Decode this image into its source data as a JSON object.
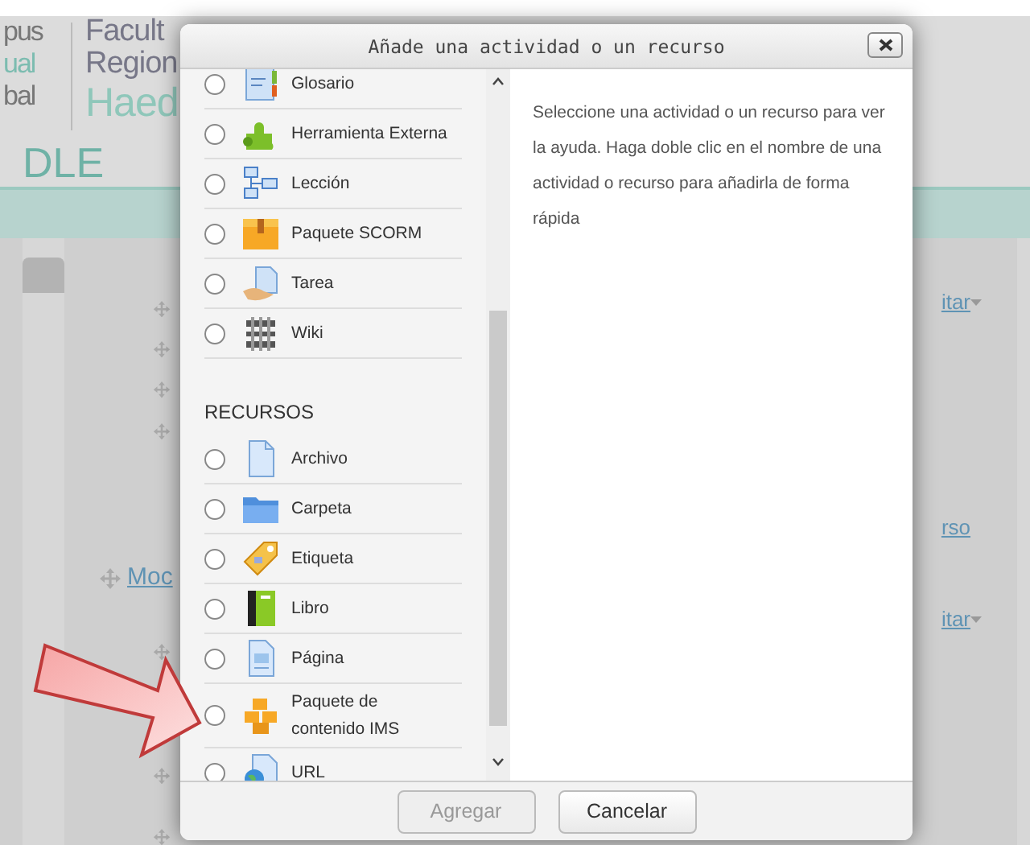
{
  "background": {
    "logo_left": [
      "pus",
      "ual",
      "bal"
    ],
    "logo_right": [
      "Facult",
      "Region",
      "Haed"
    ],
    "site_name": "DLE",
    "section_link": "Moc",
    "edit_links": [
      "itar",
      "itar"
    ],
    "side_link": "rso"
  },
  "dialog": {
    "title": "Añade una actividad o un recurso",
    "sections": [
      {
        "items": [
          {
            "label": "Glosario",
            "selected": false
          },
          {
            "label": "Herramienta Externa",
            "selected": false
          },
          {
            "label": "Lección",
            "selected": false
          },
          {
            "label": "Paquete SCORM",
            "selected": false
          },
          {
            "label": "Tarea",
            "selected": false
          },
          {
            "label": "Wiki",
            "selected": false
          }
        ]
      },
      {
        "heading": "RECURSOS",
        "items": [
          {
            "label": "Archivo",
            "selected": false
          },
          {
            "label": "Carpeta",
            "selected": false
          },
          {
            "label": "Etiqueta",
            "selected": false
          },
          {
            "label": "Libro",
            "selected": false
          },
          {
            "label": "Página",
            "selected": false
          },
          {
            "label": "Paquete de contenido IMS",
            "selected": false
          },
          {
            "label": "URL",
            "selected": false
          }
        ]
      }
    ],
    "help": "Seleccione una actividad o un recurso para ver la ayuda. Haga doble clic en el nombre de una actividad o recurso para añadirla de forma rápida",
    "buttons": [
      {
        "label": "Agregar",
        "disabled": true
      },
      {
        "label": "Cancelar",
        "disabled": false
      }
    ]
  }
}
